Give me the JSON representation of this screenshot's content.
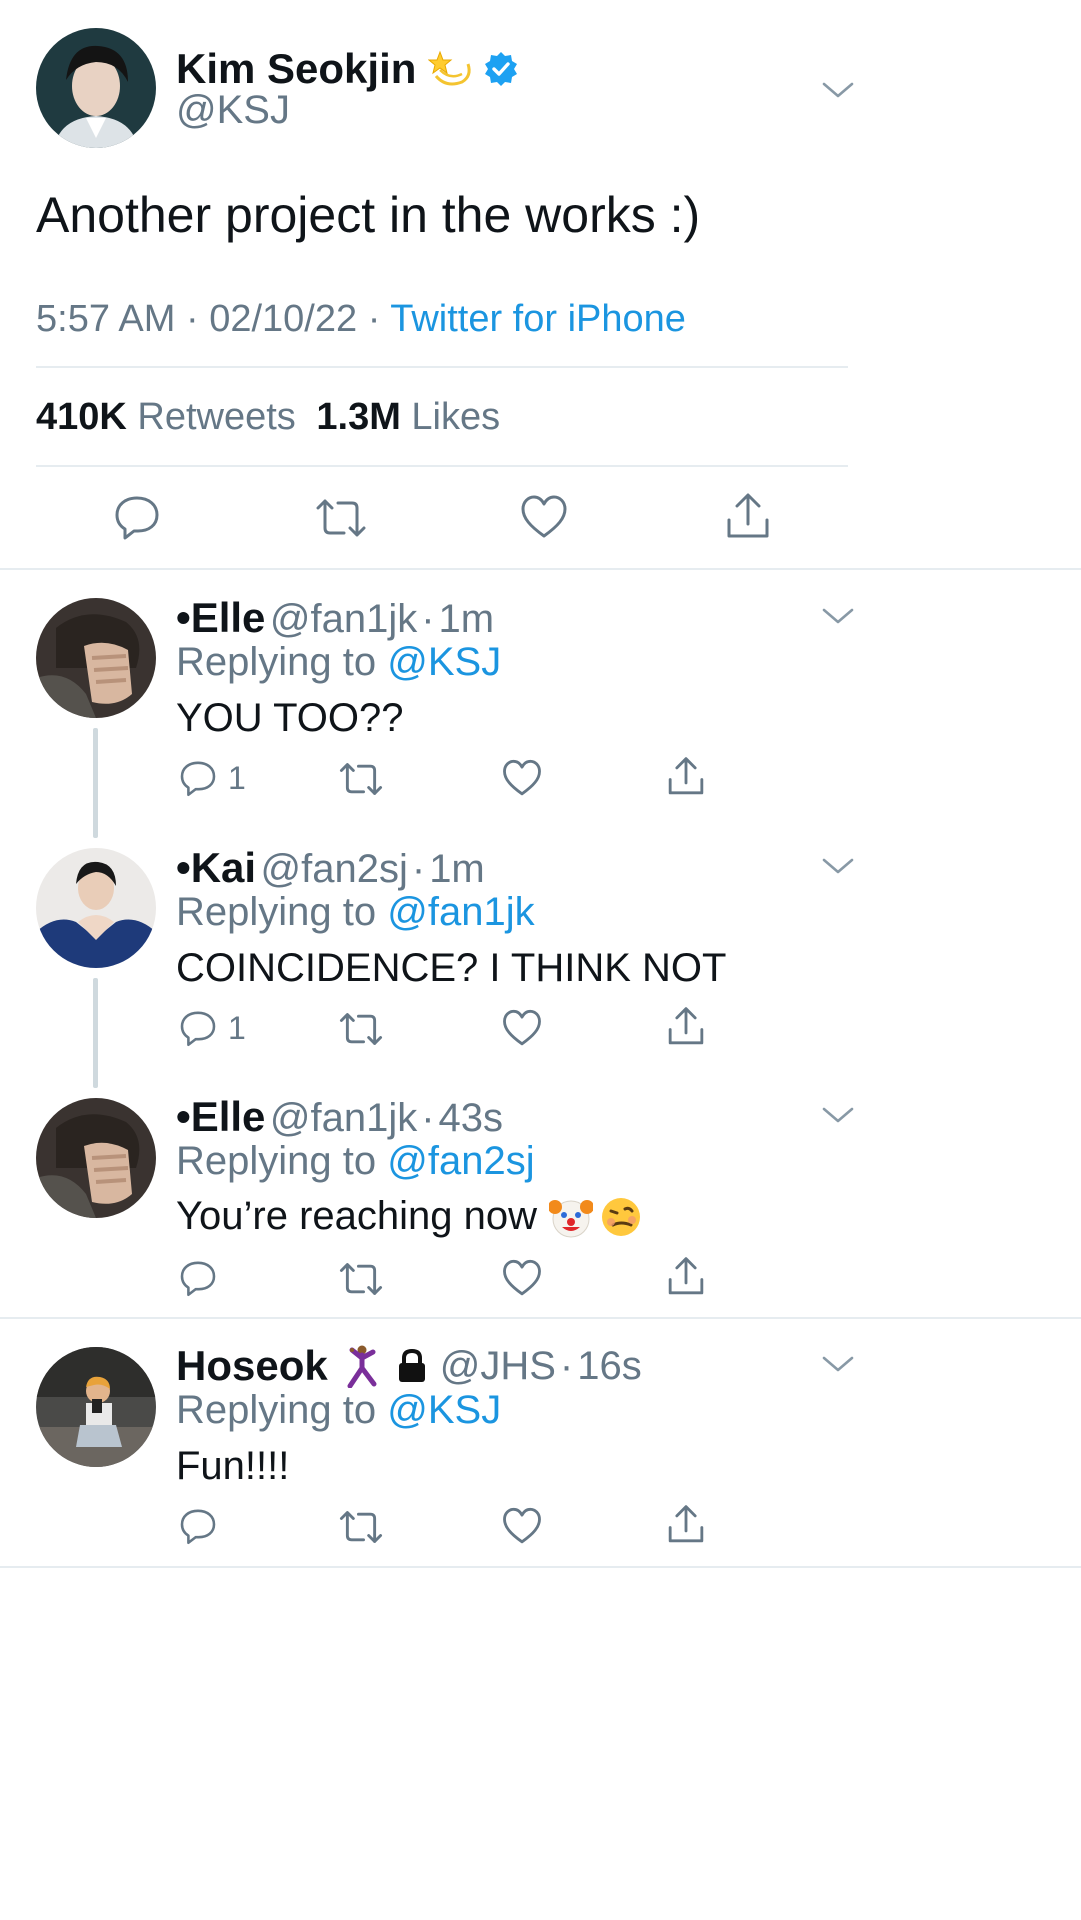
{
  "tweet": {
    "author_name": "Kim Seokjin",
    "author_handle": "@KSJ",
    "text": "Another project in the works :)",
    "time": "5:57 AM",
    "date": "02/10/22",
    "source": "Twitter for iPhone",
    "separator": "·",
    "retweets_count": "410K",
    "retweets_label": "Retweets",
    "likes_count": "1.3M",
    "likes_label": "Likes",
    "emoji": "dizzy-star",
    "verified_color": "#1da1f2"
  },
  "replying_label": "Replying to",
  "replies": [
    {
      "name": "•Elle",
      "handle": "@fan1jk",
      "sep": "·",
      "time": "1m",
      "replying_to": "@KSJ",
      "text": "YOU TOO??",
      "reply_count": "1"
    },
    {
      "name": "•Kai",
      "handle": "@fan2sj",
      "sep": "·",
      "time": "1m",
      "replying_to": "@fan1jk",
      "text": "COINCIDENCE? I THINK NOT",
      "reply_count": "1"
    },
    {
      "name": "•Elle",
      "handle": "@fan1jk",
      "sep": "·",
      "time": "43s",
      "replying_to": "@fan2sj",
      "text": "You’re reaching now",
      "emojis": [
        "clown-face",
        "woozy-face"
      ],
      "reply_count": ""
    },
    {
      "name": "Hoseok",
      "handle": "@JHS",
      "sep": "·",
      "time": "16s",
      "replying_to": "@KSJ",
      "text": "Fun!!!!",
      "badges": [
        "dancing-man",
        "lock"
      ],
      "reply_count": ""
    }
  ],
  "colors": {
    "link": "#1b95e0",
    "secondary": "#657786",
    "divider": "#e6ecf0"
  }
}
